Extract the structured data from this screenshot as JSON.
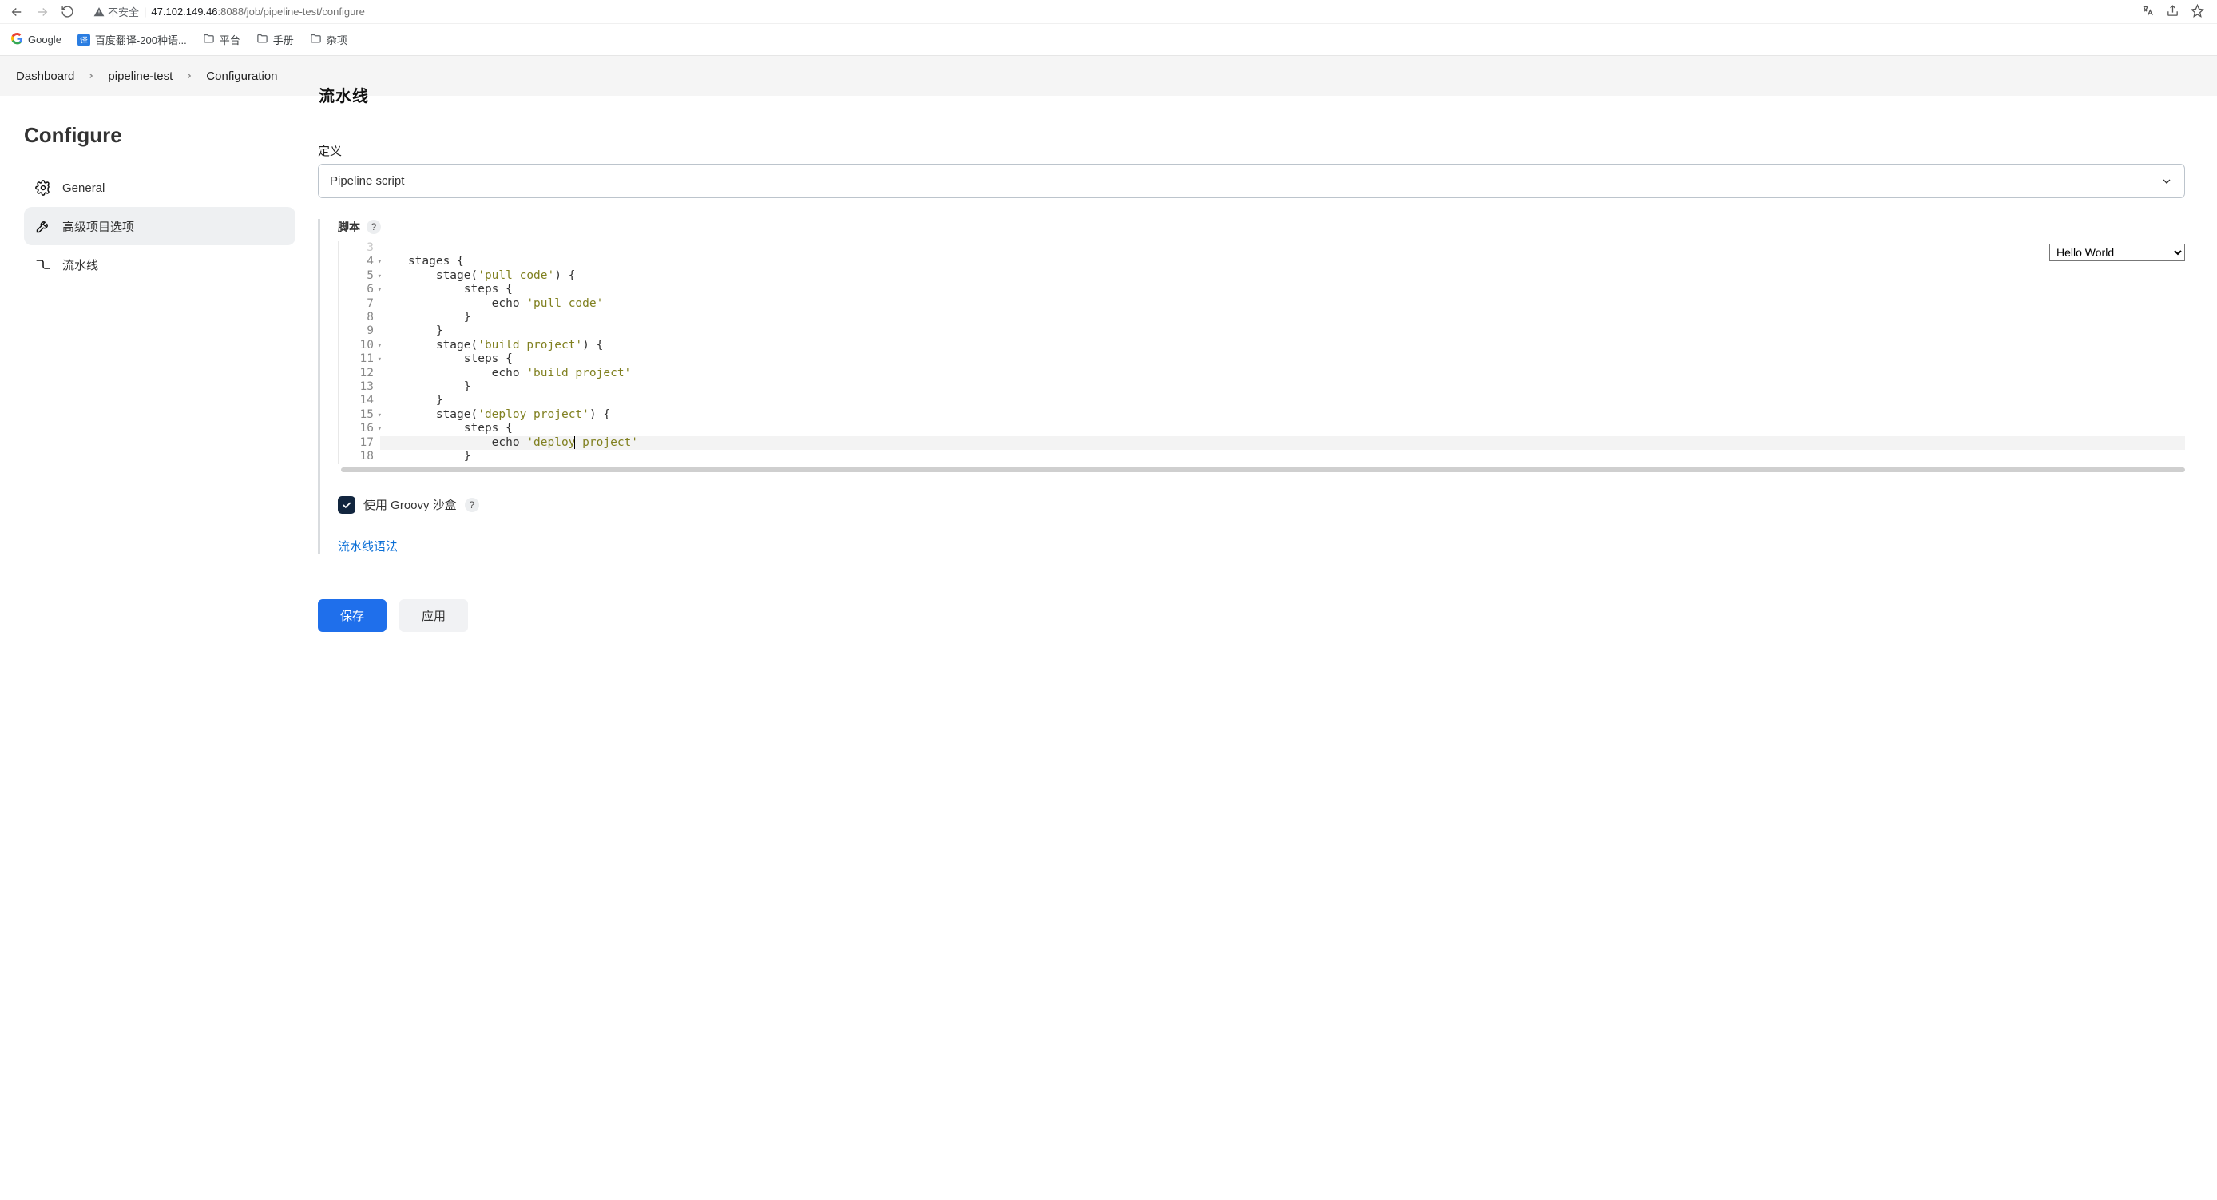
{
  "browser": {
    "insecure_label": "不安全",
    "url_host": "47.102.149.46",
    "url_port": ":8088",
    "url_path": "/job/pipeline-test/configure"
  },
  "bookmarks": {
    "google": "Google",
    "baidu": "百度翻译-200种语...",
    "platform": "平台",
    "manual": "手册",
    "misc": "杂项"
  },
  "breadcrumbs": {
    "dashboard": "Dashboard",
    "job": "pipeline-test",
    "configuration": "Configuration"
  },
  "cutoff_heading": "流水线",
  "sidebar": {
    "title": "Configure",
    "general": "General",
    "advanced": "高级项目选项",
    "pipeline": "流水线"
  },
  "main": {
    "definition_label": "定义",
    "definition_value": "Pipeline script",
    "script_label": "脚本",
    "template_selected": "Hello World",
    "sandbox_label": "使用 Groovy 沙盒",
    "syntax_link": "流水线语法",
    "save": "保存",
    "apply": "应用"
  },
  "editor": {
    "lines": [
      {
        "n": 3,
        "fold": false
      },
      {
        "n": 4,
        "fold": true
      },
      {
        "n": 5,
        "fold": true
      },
      {
        "n": 6,
        "fold": true
      },
      {
        "n": 7,
        "fold": false
      },
      {
        "n": 8,
        "fold": false
      },
      {
        "n": 9,
        "fold": false
      },
      {
        "n": 10,
        "fold": true
      },
      {
        "n": 11,
        "fold": true
      },
      {
        "n": 12,
        "fold": false
      },
      {
        "n": 13,
        "fold": false
      },
      {
        "n": 14,
        "fold": false
      },
      {
        "n": 15,
        "fold": true
      },
      {
        "n": 16,
        "fold": true
      },
      {
        "n": 17,
        "fold": false,
        "hl": true
      },
      {
        "n": 18,
        "fold": false
      }
    ],
    "code": {
      "l4": {
        "pre": "    stages {"
      },
      "l5": {
        "pre": "        stage(",
        "str": "'pull code'",
        "post": ") {"
      },
      "l6": {
        "pre": "            steps {"
      },
      "l7": {
        "pre": "                echo ",
        "str": "'pull code'"
      },
      "l8": {
        "pre": "            }"
      },
      "l9": {
        "pre": "        }"
      },
      "l10": {
        "pre": "        stage(",
        "str": "'build project'",
        "post": ") {"
      },
      "l11": {
        "pre": "            steps {"
      },
      "l12": {
        "pre": "                echo ",
        "str": "'build project'"
      },
      "l13": {
        "pre": "            }"
      },
      "l14": {
        "pre": "        }"
      },
      "l15": {
        "pre": "        stage(",
        "str": "'deploy project'",
        "post": ") {"
      },
      "l16": {
        "pre": "            steps {"
      },
      "l17": {
        "pre": "                echo ",
        "strA": "'deploy",
        "strB": " project'"
      },
      "l18": {
        "pre": "            }"
      }
    }
  }
}
